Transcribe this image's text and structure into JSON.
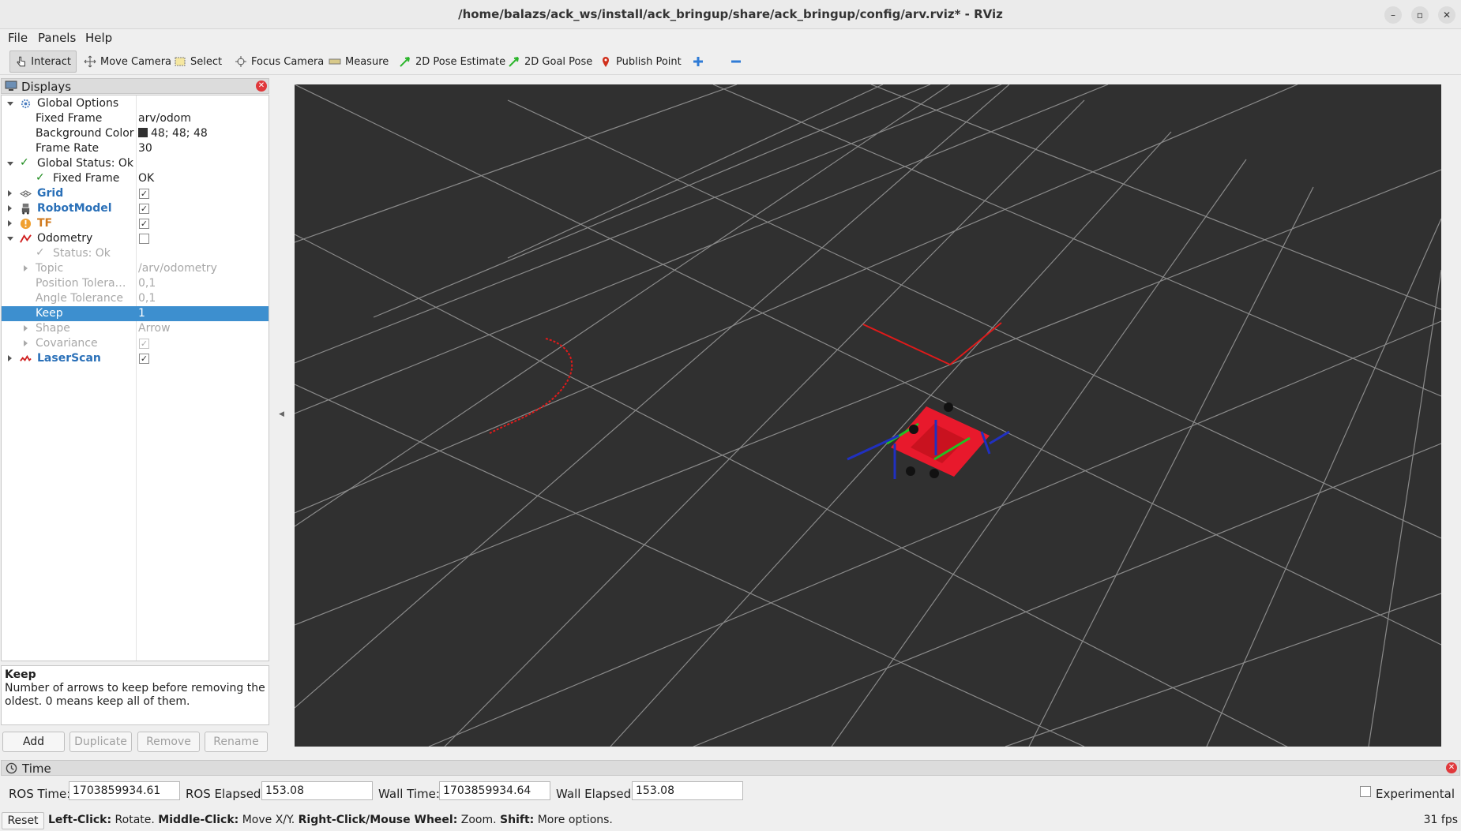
{
  "window": {
    "title": "/home/balazs/ack_ws/install/ack_bringup/share/ack_bringup/config/arv.rviz* - RViz"
  },
  "menu": {
    "file": "File",
    "panels": "Panels",
    "help": "Help"
  },
  "toolbar": {
    "interact": "Interact",
    "move_camera": "Move Camera",
    "select": "Select",
    "focus_camera": "Focus Camera",
    "measure": "Measure",
    "pose_estimate": "2D Pose Estimate",
    "goal_pose": "2D Goal Pose",
    "publish_point": "Publish Point"
  },
  "displays": {
    "title": "Displays",
    "global_options": "Global Options",
    "fixed_frame_label": "Fixed Frame",
    "fixed_frame_value": "arv/odom",
    "background_color_label": "Background Color",
    "background_color_value": "48; 48; 48",
    "frame_rate_label": "Frame Rate",
    "frame_rate_value": "30",
    "global_status": "Global Status: Ok",
    "status_fixed_frame_label": "Fixed Frame",
    "status_fixed_frame_value": "OK",
    "grid": "Grid",
    "robot_model": "RobotModel",
    "tf": "TF",
    "odometry": "Odometry",
    "odom_status": "Status: Ok",
    "topic_label": "Topic",
    "topic_value": "/arv/odometry",
    "position_tolerance_label": "Position Tolera…",
    "position_tolerance_value": "0,1",
    "angle_tolerance_label": "Angle Tolerance",
    "angle_tolerance_value": "0,1",
    "keep_label": "Keep",
    "keep_value": "1",
    "shape_label": "Shape",
    "shape_value": "Arrow",
    "covariance_label": "Covariance",
    "laser_scan": "LaserScan"
  },
  "description": {
    "title": "Keep",
    "text": "Number of arrows to keep before removing the oldest. 0 means keep all of them."
  },
  "panel_buttons": {
    "add": "Add",
    "duplicate": "Duplicate",
    "remove": "Remove",
    "rename": "Rename"
  },
  "time": {
    "title": "Time",
    "ros_time_label": "ROS Time:",
    "ros_time_value": "1703859934.61",
    "ros_elapsed_label": "ROS Elapsed:",
    "ros_elapsed_value": "153.08",
    "wall_time_label": "Wall Time:",
    "wall_time_value": "1703859934.64",
    "wall_elapsed_label": "Wall Elapsed:",
    "wall_elapsed_value": "153.08",
    "experimental_label": "Experimental"
  },
  "status": {
    "reset": "Reset",
    "hint_left_key": "Left-Click:",
    "hint_left_val": " Rotate. ",
    "hint_middle_key": "Middle-Click:",
    "hint_middle_val": " Move X/Y. ",
    "hint_right_key": "Right-Click/Mouse Wheel:",
    "hint_right_val": " Zoom. ",
    "hint_shift_key": "Shift:",
    "hint_shift_val": " More options.",
    "fps": "31 fps"
  },
  "colors": {
    "view_background": "#303030",
    "selection": "#3d8fcf",
    "display_name_blue": "#2a70b8",
    "tf_orange": "#d07a1e",
    "robot_red": "#e8192c"
  }
}
